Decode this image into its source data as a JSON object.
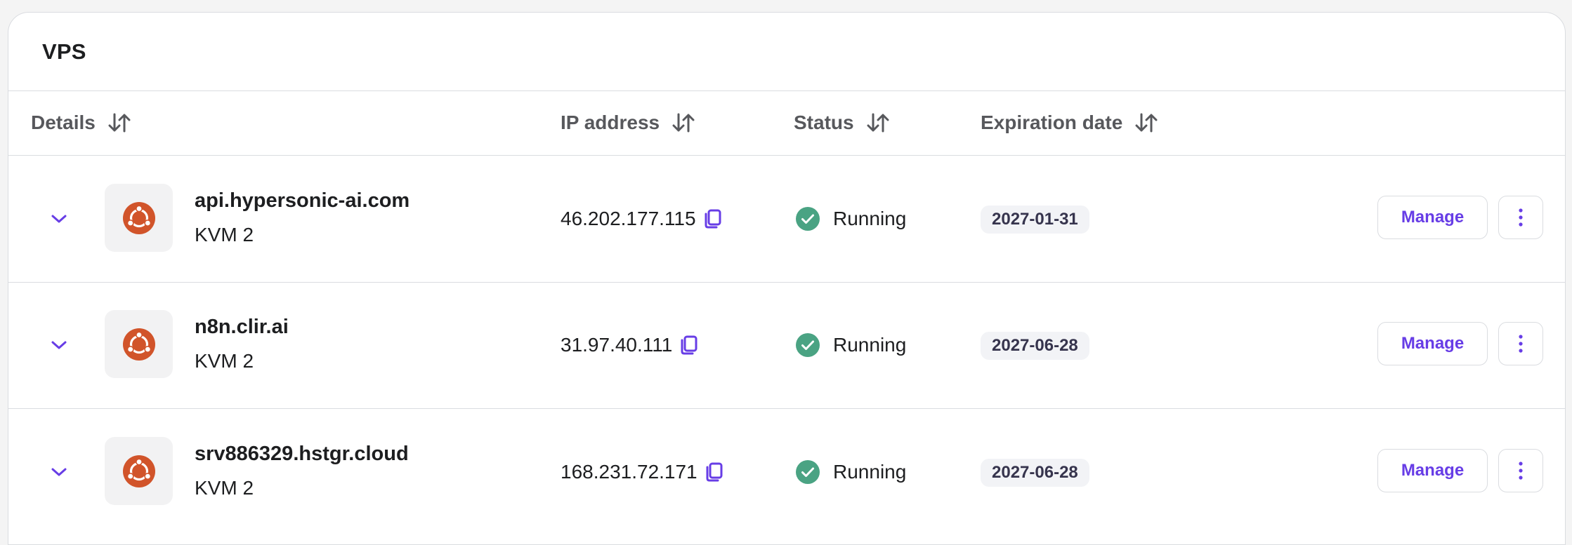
{
  "card": {
    "title": "VPS"
  },
  "table": {
    "columns": [
      {
        "key": "details",
        "label": "Details"
      },
      {
        "key": "ip",
        "label": "IP address"
      },
      {
        "key": "status",
        "label": "Status"
      },
      {
        "key": "expiration",
        "label": "Expiration date"
      }
    ],
    "rows": [
      {
        "hostname": "api.hypersonic-ai.com",
        "plan": "KVM 2",
        "ip": "46.202.177.115",
        "status": "Running",
        "expiration": "2027-01-31",
        "manage_label": "Manage",
        "os_icon": "ubuntu-icon"
      },
      {
        "hostname": "n8n.clir.ai",
        "plan": "KVM 2",
        "ip": "31.97.40.111",
        "status": "Running",
        "expiration": "2027-06-28",
        "manage_label": "Manage",
        "os_icon": "ubuntu-icon"
      },
      {
        "hostname": "srv886329.hstgr.cloud",
        "plan": "KVM 2",
        "ip": "168.231.72.171",
        "status": "Running",
        "expiration": "2027-06-28",
        "manage_label": "Manage",
        "os_icon": "ubuntu-icon"
      }
    ]
  },
  "icons": {
    "sort": "sort-arrows-icon",
    "expand": "chevron-down-icon",
    "copy": "copy-icon",
    "status_ok": "check-circle-icon",
    "more": "more-vertical-icon"
  },
  "colors": {
    "accent": "#673de6",
    "status_running": "#4aa383",
    "ubuntu": "#d1542a",
    "border": "#dadce0",
    "badge_bg": "#f2f3f6"
  }
}
